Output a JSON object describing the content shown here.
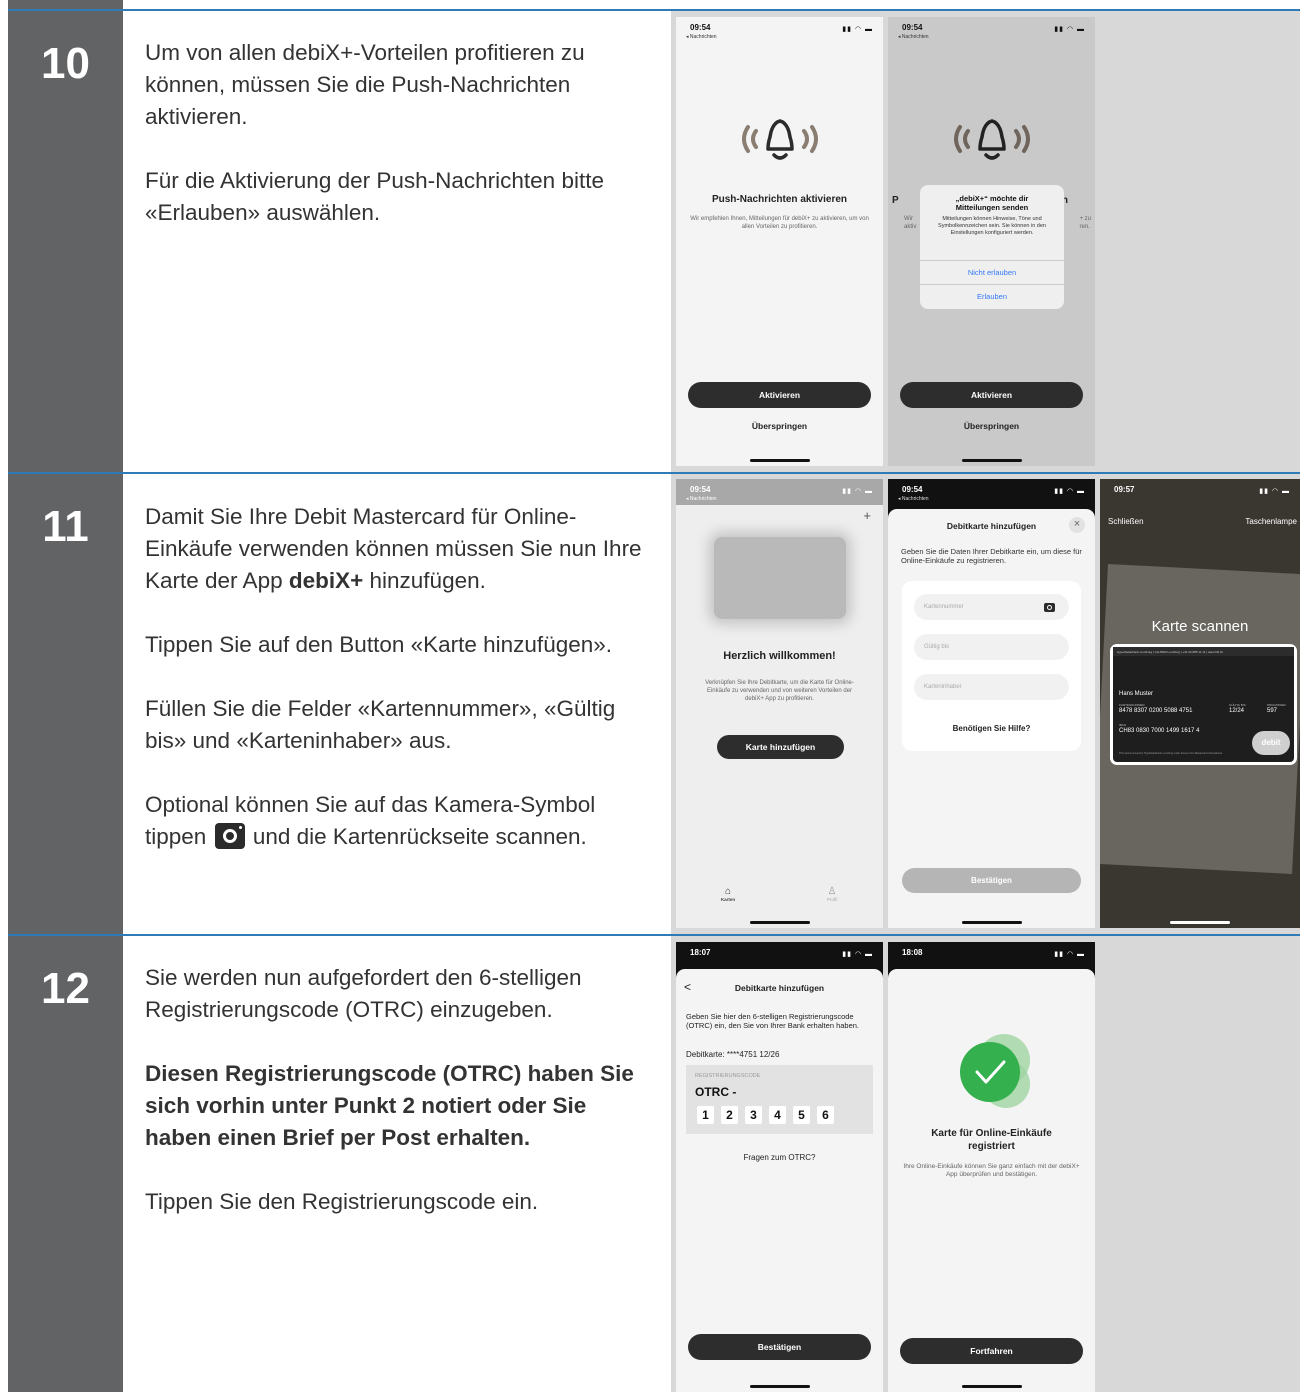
{
  "steps": [
    {
      "number": "10",
      "paragraphs": [
        "Um von allen debiX+-Vorteilen profitieren zu können, müssen Sie die Push-Nachrichten aktivieren.",
        "Für die Aktivierung der Push-Nachrichten bitte «Erlauben» auswählen."
      ]
    },
    {
      "number": "11",
      "p1_pre": "Damit Sie Ihre Debit Mastercard für Online-Einkäufe verwenden können müssen Sie nun Ihre Karte der App ",
      "p1_bold": "debiX+",
      "p1_post": " hinzufügen.",
      "p2": "Tippen Sie auf den Button «Karte hinzufügen».",
      "p3": "Füllen Sie die Felder «Kartennummer», «Gültig bis» und «Karteninhaber» aus.",
      "p4_pre": "Optional können Sie auf das Kamera-Symbol tippen",
      "p4_post": " und die Kartenrückseite scannen.",
      "camera_icon": "camera-icon"
    },
    {
      "number": "12",
      "p1": "Sie werden nun aufgefordert den 6-stelligen Registrierungscode (OTRC) einzugeben.",
      "p2_bold": "Diesen Registrierungscode (OTRC) haben Sie sich vorhin unter Punkt 2 notiert oder Sie haben einen Brief per Post erhalten.",
      "p3": "Tippen Sie den Registrierungscode ein."
    }
  ],
  "screens": {
    "push1": {
      "time": "09:54",
      "back": "◂ Nachrichten",
      "title": "Push-Nachrichten aktivieren",
      "desc": "Wir empfehlen Ihnen, Mitteilungen für debiX+ zu aktivieren, um von allen Vorteilen zu profitieren.",
      "activate": "Aktivieren",
      "skip": "Überspringen"
    },
    "push2": {
      "time": "09:54",
      "back": "◂ Nachrichten",
      "title_left": "P",
      "title_right": "n",
      "desc_left": "Wir\naktiv",
      "desc_right": "+ zu\nren.",
      "alert_title": "„debiX+“ möchte dir Mitteilungen senden",
      "alert_body": "Mitteilungen können Hinweise, Töne und Symbolkennzeichen sein. Sie können in den Einstellungen konfiguriert werden.",
      "deny": "Nicht erlauben",
      "allow": "Erlauben",
      "activate": "Aktivieren",
      "skip": "Überspringen"
    },
    "welcome": {
      "time": "09:54",
      "back": "◂ Nachrichten",
      "plus": "+",
      "title": "Herzlich willkommen!",
      "desc": "Verknüpfen Sie Ihre Debitkarte, um die Karte für Online-Einkäufe zu verwenden und von weiteren Vorteilen der debiX+ App zu profitieren.",
      "button": "Karte hinzufügen",
      "tab_cards": "Karten",
      "tab_profile": "Profil"
    },
    "addcard": {
      "time": "09:54",
      "back": "◂ Nachrichten",
      "title": "Debitkarte hinzufügen",
      "close": "×",
      "desc": "Geben Sie die Daten Ihrer Debitkarte ein, um diese für Online-Einkäufe zu registrieren.",
      "f1": "Kartennummer",
      "f2": "Gültig bis",
      "f3": "Karteninhaber",
      "help": "Benötigen Sie Hilfe?",
      "confirm": "Bestätigen"
    },
    "scan": {
      "time": "09:57",
      "close": "Schließen",
      "torch": "Taschenlampe",
      "title": "Karte scannen",
      "card_header": "Hypothekarbank Lenzburg | CH-5600 Lenzburg | +41 62 885 11 11 | www.hbl.ch",
      "holder": "Hans Muster",
      "num_label": "KARTENNUMMER",
      "num": "8478 8307 0200 5088 4751",
      "valid_label": "GÜLTIG BIS",
      "valid": "12/24",
      "cvc_label": "PRÜFZIFFER",
      "cvc": "597",
      "iban_label": "IBAN",
      "iban": "CH83 0830 7000 1499 1617 4",
      "brand": "debit",
      "footnote": "This card is issued by Hypothekarbank Lenzburg under license from Mastercard International."
    },
    "otrc": {
      "time": "18:07",
      "back": "<",
      "title": "Debitkarte hinzufügen",
      "desc": "Geben Sie hier den 6-stelligen Registrierungscode (OTRC) ein, den Sie von Ihrer Bank erhalten haben.",
      "card": "Debitkarte: ****4751 12/26",
      "label": "REGISTRIERUNGSCODE",
      "prefix": "OTRC -",
      "digits": [
        "1",
        "2",
        "3",
        "4",
        "5",
        "6"
      ],
      "faq": "Fragen zum OTRC?",
      "confirm": "Bestätigen"
    },
    "done": {
      "time": "18:08",
      "title": "Karte für Online-Einkäufe registriert",
      "desc": "Ihre Online-Einkäufe können Sie ganz einfach mit der debiX+ App überprüfen und bestätigen.",
      "continue": "Fortfahren"
    }
  },
  "colors": {
    "sidebar": "#626365",
    "separator": "#2e7bb8",
    "success": "#34b04e",
    "ios_blue": "#3478f6"
  }
}
